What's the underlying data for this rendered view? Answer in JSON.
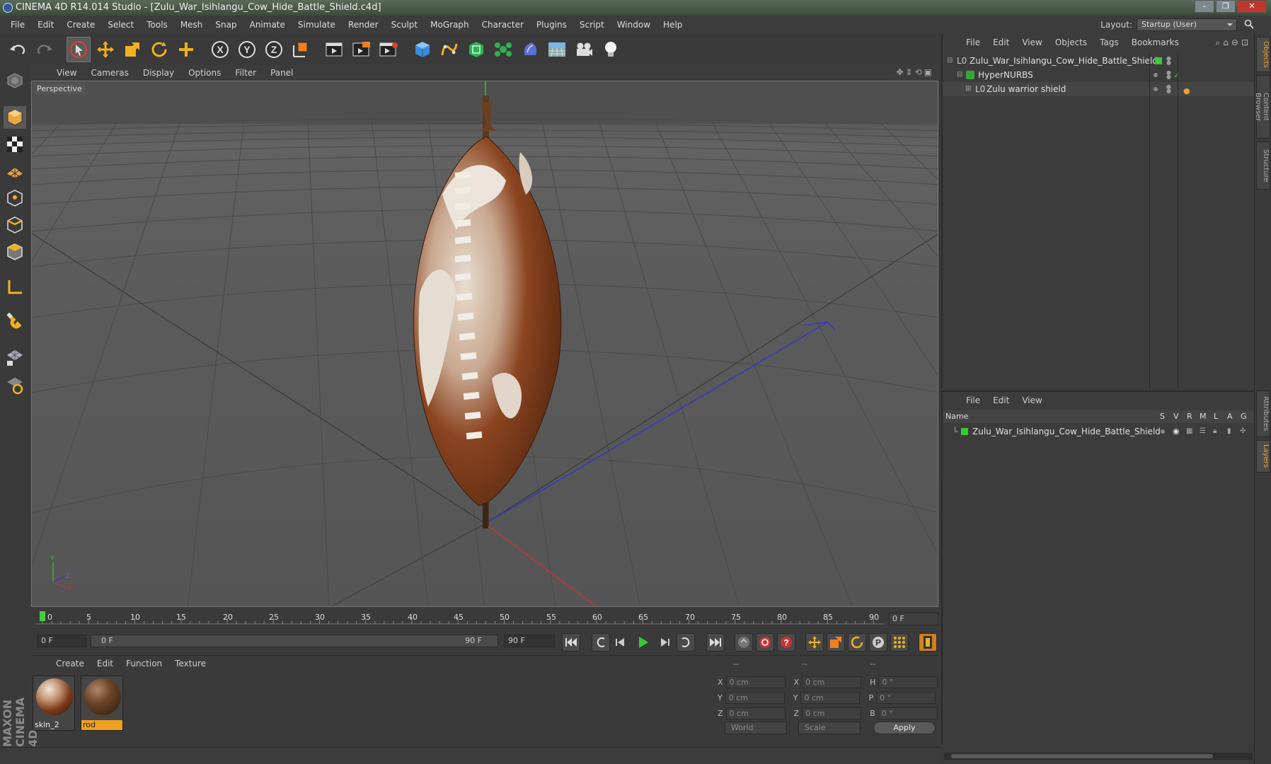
{
  "window": {
    "title": "CINEMA 4D R14.014 Studio - [Zulu_War_Isihlangu_Cow_Hide_Battle_Shield.c4d]"
  },
  "menu": [
    "File",
    "Edit",
    "Create",
    "Select",
    "Tools",
    "Mesh",
    "Snap",
    "Animate",
    "Simulate",
    "Render",
    "Sculpt",
    "MoGraph",
    "Character",
    "Plugins",
    "Script",
    "Window",
    "Help"
  ],
  "layout": {
    "label": "Layout:",
    "value": "Startup (User)"
  },
  "viewport": {
    "menu": [
      "View",
      "Cameras",
      "Display",
      "Options",
      "Filter",
      "Panel"
    ],
    "label": "Perspective"
  },
  "timeline": {
    "ticks": [
      "0",
      "5",
      "10",
      "15",
      "20",
      "25",
      "30",
      "35",
      "40",
      "45",
      "50",
      "55",
      "60",
      "65",
      "70",
      "75",
      "80",
      "85",
      "90"
    ],
    "current_frame": "0 F"
  },
  "transport": {
    "start": "0 F",
    "range_start": "0 F",
    "range_end": "90 F",
    "end": "90 F"
  },
  "materials": {
    "menu": [
      "Create",
      "Edit",
      "Function",
      "Texture"
    ],
    "items": [
      {
        "name": "skin_2"
      },
      {
        "name": "rod"
      }
    ]
  },
  "brand": {
    "text": "MAXON CINEMA 4D"
  },
  "coordinates": {
    "headers": [
      "--",
      "--",
      "--"
    ],
    "rows": [
      {
        "a": "X",
        "av": "0 cm",
        "b": "X",
        "bv": "0 cm",
        "c": "H",
        "cv": "0 °"
      },
      {
        "a": "Y",
        "av": "0 cm",
        "b": "Y",
        "bv": "0 cm",
        "c": "P",
        "cv": "0 °"
      },
      {
        "a": "Z",
        "av": "0 cm",
        "b": "Z",
        "bv": "0 cm",
        "c": "B",
        "cv": "0 °"
      }
    ],
    "mode1": "World",
    "mode2": "Scale",
    "apply": "Apply"
  },
  "objects": {
    "menu": [
      "File",
      "Edit",
      "View",
      "Objects",
      "Tags",
      "Bookmarks"
    ],
    "tree": [
      {
        "name": "Zulu_War_Isihlangu_Cow_Hide_Battle_Shield"
      },
      {
        "name": "HyperNURBS"
      },
      {
        "name": "Zulu warrior shield"
      }
    ]
  },
  "layers": {
    "menu": [
      "File",
      "Edit",
      "View"
    ],
    "columns": {
      "name": "Name",
      "flags": [
        "S",
        "V",
        "R",
        "M",
        "L",
        "A",
        "G"
      ]
    },
    "items": [
      {
        "name": "Zulu_War_Isihlangu_Cow_Hide_Battle_Shield"
      }
    ]
  },
  "side_tabs": [
    "Objects",
    "Content Browser",
    "Structure",
    "Attributes",
    "Layers"
  ],
  "colors": {
    "accent": "#f0a030",
    "layer_green": "#33cc33",
    "selection": "#5a5a5a"
  }
}
